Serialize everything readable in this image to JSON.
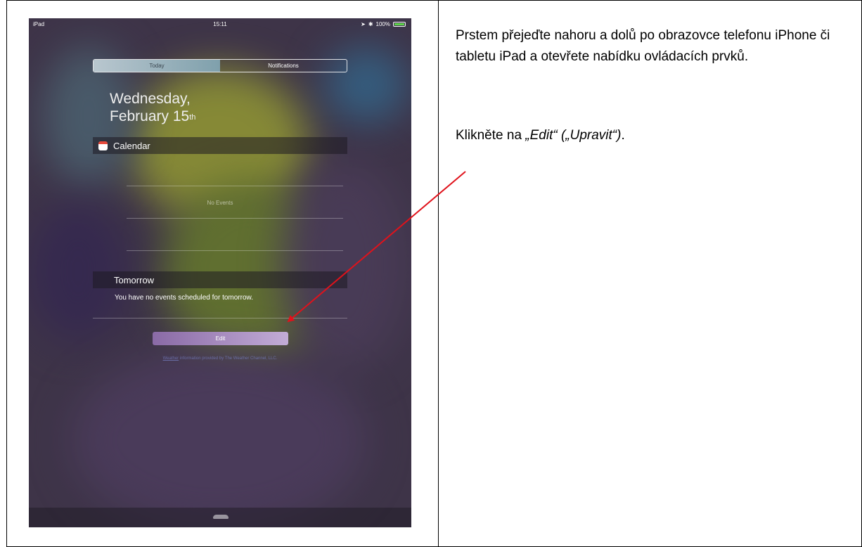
{
  "ipad": {
    "status": {
      "device": "iPad",
      "time": "15:11",
      "battery": "100%"
    },
    "tabs": {
      "today": "Today",
      "notifications": "Notifications"
    },
    "date_line1": "Wednesday,",
    "date_line2": "February 15",
    "date_suffix": "th",
    "calendar_title": "Calendar",
    "no_events": "No Events",
    "tomorrow_title": "Tomorrow",
    "tomorrow_text": "You have no events scheduled for tomorrow.",
    "edit_button": "Edit",
    "weather_link": "Weather",
    "weather_rest": " information provided by The Weather Channel, LLC."
  },
  "instructions": {
    "paragraph1": "Prstem přejeďte nahoru a dolů po obrazovce telefonu iPhone či tabletu iPad a otevřete nabídku ovládacích prvků.",
    "paragraph2_prefix": "Klikněte na ",
    "paragraph2_italic": "„Edit“ („Upravit“)",
    "paragraph2_suffix": "."
  },
  "colors": {
    "arrow": "#e0121b",
    "active_tab": "#9fb3bd"
  }
}
